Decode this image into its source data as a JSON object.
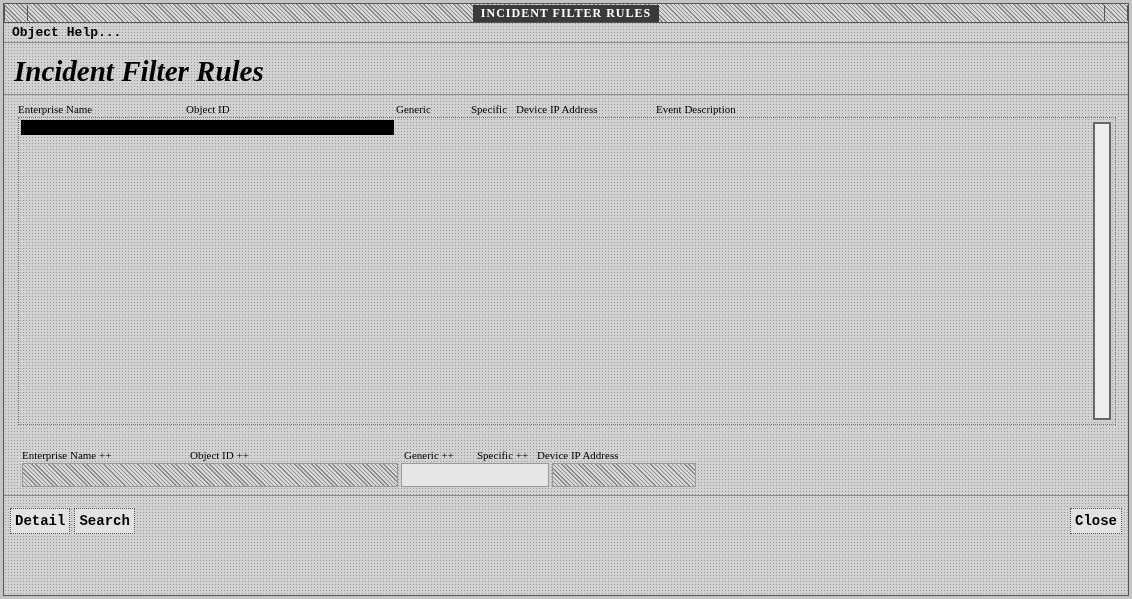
{
  "window": {
    "title": "INCIDENT FILTER RULES"
  },
  "menu": [
    "Object",
    "Help..."
  ],
  "heading": "Incident Filter Rules",
  "table": {
    "columns": [
      "Enterprise Name",
      "Object ID",
      "Generic",
      "Specific",
      "Device IP Address",
      "Event Description"
    ],
    "rows": [
      {
        "selected": true
      }
    ]
  },
  "filter": {
    "labels": [
      "Enterprise Name ++",
      "Object ID ++",
      "Generic ++",
      "Specific ++",
      "Device IP Address"
    ],
    "fields": [
      {
        "disabled": true
      },
      {
        "disabled": false
      },
      {
        "disabled": true
      }
    ]
  },
  "buttons": [
    "Detail",
    "Search"
  ],
  "close_button": "Close"
}
